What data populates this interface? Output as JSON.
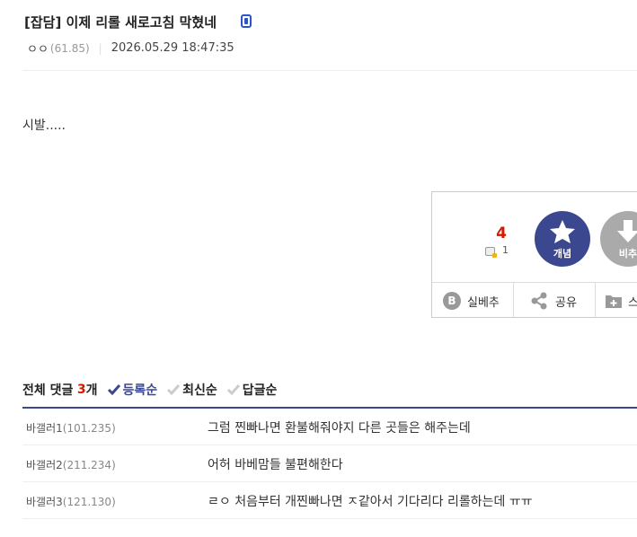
{
  "post": {
    "title": "[잡담] 이제 리롤 새로고침 막혔네",
    "author_nick": "ㅇㅇ",
    "author_ip": "(61.85)",
    "date": "2026.05.29 18:47:35",
    "body": "시발....."
  },
  "vote": {
    "recommend_count": "4",
    "fixed_count": "1",
    "up_label": "개념",
    "down_label": "비추",
    "recommend_badge": "B",
    "recommend_label": "실베추",
    "share_label": "공유",
    "scrap_label": "스"
  },
  "comments": {
    "header_label": "전체 댓글",
    "count": "3",
    "unit": "개",
    "sorts": [
      {
        "label": "등록순",
        "active": true
      },
      {
        "label": "최신순",
        "active": false
      },
      {
        "label": "답글순",
        "active": false
      }
    ],
    "items": [
      {
        "writer": "바갤러1",
        "ip": "(101.235)",
        "text": "그럼 찐빠나면 환불해줘야지 다른 곳들은 해주는데"
      },
      {
        "writer": "바갤러2",
        "ip": "(211.234)",
        "text": "어허 바베맘들 불편해한다"
      },
      {
        "writer": "바갤러3",
        "ip": "(121.130)",
        "text": "ㄹㅇ 처음부터 개찐빠나면 ㅈ같아서 기다리다 리롤하는데 ㅠㅠ"
      }
    ]
  },
  "colors": {
    "accent": "#3b4890",
    "count_red": "#d31900"
  }
}
